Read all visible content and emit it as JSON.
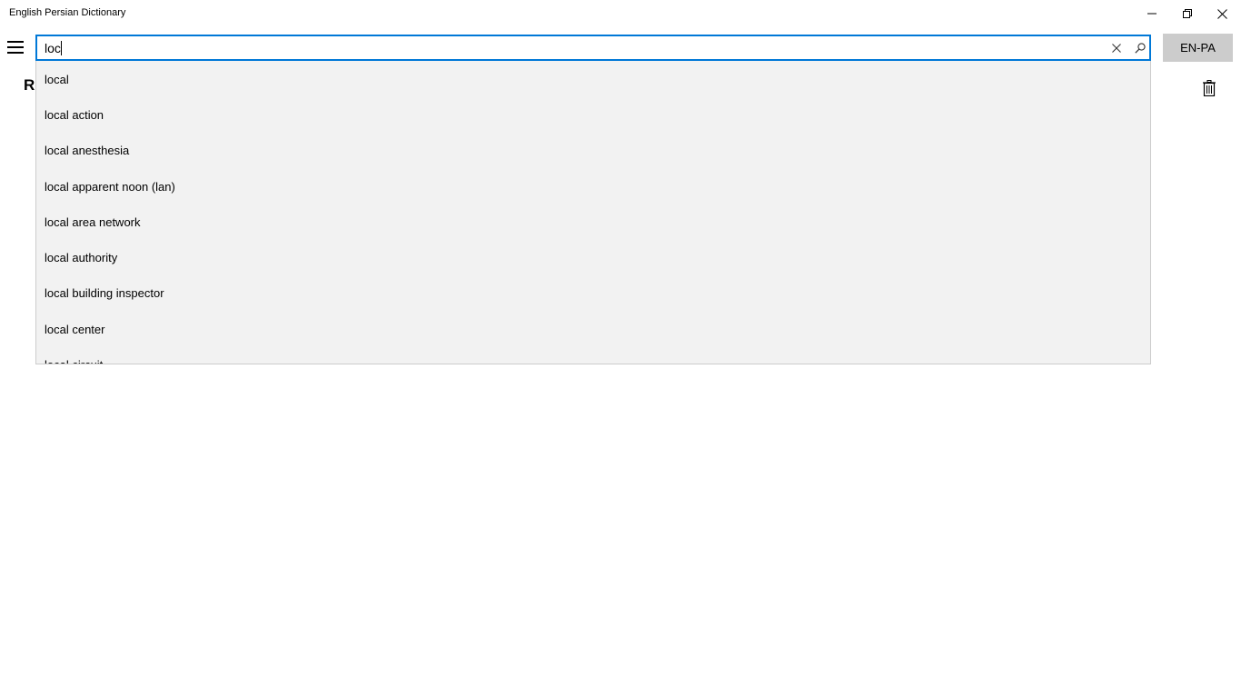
{
  "window": {
    "title": "English Persian Dictionary",
    "minimize_icon": "minimize-icon",
    "restore_icon": "restore-icon",
    "close_icon": "close-icon"
  },
  "search": {
    "value": "loc",
    "clear_icon": "close-icon",
    "search_icon": "search-icon"
  },
  "language_button": "EN-PA",
  "main": {
    "heading_partial": "Re",
    "delete_icon": "trash-icon"
  },
  "suggestions": [
    "local",
    "local action",
    "local anesthesia",
    "local apparent noon (lan)",
    "local area network",
    "local authority",
    "local building inspector",
    "local center",
    "local circuit"
  ],
  "colors": {
    "accent": "#0078d7",
    "dropdown_bg": "#f2f2f2",
    "lang_button_bg": "#cccccc"
  }
}
